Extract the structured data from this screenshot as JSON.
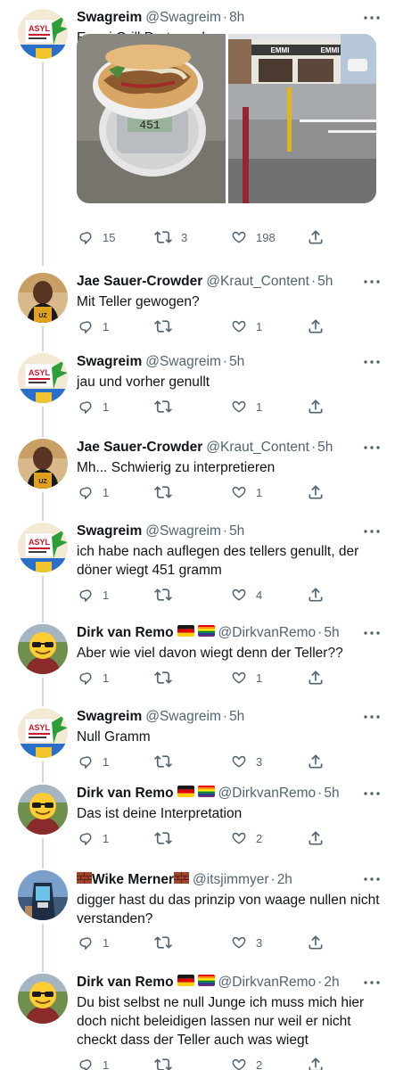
{
  "tweets": [
    {
      "name": "Swagreim",
      "handle": "@Swagreim",
      "time": "8h",
      "text": "Emmi Grill Dortmund",
      "replies": "15",
      "retweets": "3",
      "likes": "198",
      "avatar": "swagreim",
      "media": {
        "scale_reading": "451",
        "sign_left": "EMMI",
        "sign_right": "EMMI"
      }
    },
    {
      "name": "Jae Sauer-Crowder",
      "handle": "@Kraut_Content",
      "time": "5h",
      "text": "Mit Teller gewogen?",
      "replies": "1",
      "retweets": "",
      "likes": "1",
      "avatar": "jae"
    },
    {
      "name": "Swagreim",
      "handle": "@Swagreim",
      "time": "5h",
      "text": "jau und vorher genullt",
      "replies": "1",
      "retweets": "",
      "likes": "1",
      "avatar": "swagreim"
    },
    {
      "name": "Jae Sauer-Crowder",
      "handle": "@Kraut_Content",
      "time": "5h",
      "text": "Mh... Schwierig zu interpretieren",
      "replies": "1",
      "retweets": "",
      "likes": "1",
      "avatar": "jae"
    },
    {
      "name": "Swagreim",
      "handle": "@Swagreim",
      "time": "5h",
      "text": "ich habe nach auflegen des tellers genullt, der döner wiegt 451 gramm",
      "replies": "1",
      "retweets": "",
      "likes": "4",
      "avatar": "swagreim"
    },
    {
      "name": "Dirk van Remo",
      "handle": "@DirkvanRemo",
      "time": "5h",
      "text": "Aber wie viel davon wiegt denn der Teller??",
      "replies": "1",
      "retweets": "",
      "likes": "1",
      "avatar": "dirk"
    },
    {
      "name": "Swagreim",
      "handle": "@Swagreim",
      "time": "5h",
      "text": "Null Gramm",
      "replies": "1",
      "retweets": "",
      "likes": "3",
      "avatar": "swagreim"
    },
    {
      "name": "Dirk van Remo",
      "handle": "@DirkvanRemo",
      "time": "5h",
      "text": "Das ist deine Interpretation",
      "replies": "1",
      "retweets": "",
      "likes": "2",
      "avatar": "dirk"
    },
    {
      "name": "Wike Merner",
      "handle": "@itsjimmyer",
      "time": "2h",
      "text": "digger hast du das prinzip von waage nullen nicht verstanden?",
      "replies": "1",
      "retweets": "",
      "likes": "3",
      "avatar": "wike"
    },
    {
      "name": "Dirk van Remo",
      "handle": "@DirkvanRemo",
      "time": "2h",
      "text": "Du bist selbst ne null Junge ich muss mich hier doch nicht beleidigen lassen nur weil er nicht checkt dass der Teller auch was wiegt",
      "replies": "1",
      "retweets": "",
      "likes": "2",
      "avatar": "dirk"
    }
  ],
  "icons": {
    "reply": "reply-icon",
    "retweet": "retweet-icon",
    "like": "like-icon",
    "share": "share-icon",
    "more": "more-icon"
  },
  "colors": {
    "text": "#0f1419",
    "secondary": "#536471",
    "thread_line": "#cfd9de"
  }
}
